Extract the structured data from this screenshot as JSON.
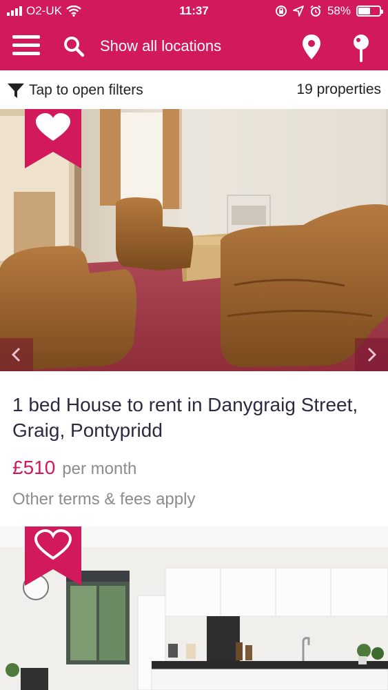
{
  "status_bar": {
    "carrier": "O2-UK",
    "time": "11:37",
    "battery": "58%",
    "battery_level": 0.58
  },
  "app_bar": {
    "search_label": "Show all locations"
  },
  "filter_bar": {
    "filter_label": "Tap to open filters",
    "count_label": "19 properties"
  },
  "listings": [
    {
      "title": "1 bed House to rent in Danygraig Street, Graig, Pontypridd",
      "price": "£510",
      "period": "per month",
      "terms": "Other terms & fees apply",
      "favorited": true
    },
    {
      "favorited": false
    }
  ],
  "colors": {
    "brand": "#d1195c",
    "title_text": "#2d2940",
    "muted_text": "#8c8c8c"
  }
}
